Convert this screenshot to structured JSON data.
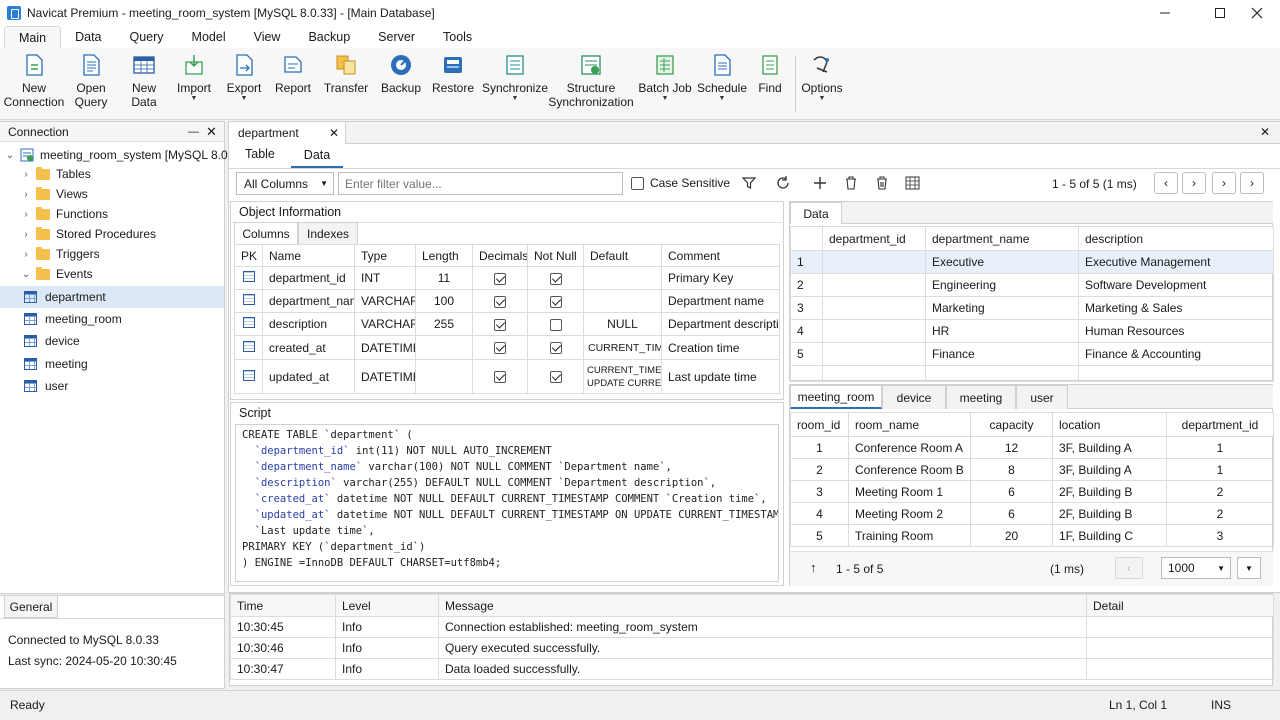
{
  "window": {
    "title": "Navicat Premium - meeting_room_system [MySQL 8.0.33] - [Main Database]"
  },
  "menu": [
    "Main",
    "Data",
    "Query",
    "Model",
    "View",
    "Backup",
    "Server",
    "Tools"
  ],
  "ribbon": {
    "new_connection": "New\nConnection",
    "open_query": "Open\nQuery",
    "new_data": "New\nData",
    "import": "Import",
    "export": "Export",
    "report": "Report",
    "transfer": "Transfer",
    "backup": "Backup",
    "restore": "Restore",
    "synchronize": "Synchronize",
    "structure_sync": "Structure\nSynchronization",
    "batch_job": "Batch Job",
    "schedule": "Schedule",
    "find": "Find",
    "options": "Options"
  },
  "connection_panel": {
    "title": "Connection",
    "root": "meeting_room_system [MySQL 8.0.33]",
    "folders": [
      "Tables",
      "Views",
      "Functions",
      "Stored Procedures",
      "Triggers",
      "Events"
    ],
    "tables": [
      "department",
      "meeting_room",
      "device",
      "meeting",
      "user"
    ]
  },
  "general_panel": {
    "tab": "General",
    "connected": "Connected to MySQL 8.0.33",
    "last_sync": "Last sync: 2024-05-20 10:30:45"
  },
  "editor": {
    "doc_tab": "department",
    "subtabs": [
      "Table",
      "Data"
    ],
    "filter": {
      "column_select": "All Columns",
      "placeholder": "Enter filter value...",
      "case_sensitive": "Case Sensitive"
    },
    "paging": "1 - 5 of 5 (1 ms)"
  },
  "object_info": {
    "title": "Object Information",
    "tabs": [
      "Columns",
      "Indexes"
    ],
    "headers": [
      "PK",
      "Name",
      "Type",
      "Length",
      "Decimals",
      "Not Null",
      "Default",
      "Comment"
    ],
    "rows": [
      {
        "name": "department_id",
        "type": "INT",
        "length": "11",
        "decimals": true,
        "notnull": true,
        "default": "",
        "comment": "Primary Key"
      },
      {
        "name": "department_name",
        "type": "VARCHAR",
        "length": "100",
        "decimals": true,
        "notnull": true,
        "default": "",
        "comment": "Department name"
      },
      {
        "name": "description",
        "type": "VARCHAR",
        "length": "255",
        "decimals": true,
        "notnull": false,
        "default": "NULL",
        "comment": "Department description"
      },
      {
        "name": "created_at",
        "type": "DATETIME",
        "length": "",
        "decimals": true,
        "notnull": true,
        "default": "CURRENT_TIMESTAMP",
        "comment": "Creation time"
      },
      {
        "name": "updated_at",
        "type": "DATETIME",
        "length": "",
        "decimals": true,
        "notnull": true,
        "default": "CURRENT_TIMESTAMP ON\nUPDATE CURRENT_TIMESTAMP",
        "comment": "Last update time"
      }
    ]
  },
  "script": {
    "title": "Script",
    "lines": [
      [
        "CREATE TABLE `department` (",
        ""
      ],
      [
        "  `department_id`",
        " int(11) NOT NULL AUTO_INCREMENT"
      ],
      [
        "  `department_name`",
        " varchar(100) NOT NULL COMMENT `Department name`,"
      ],
      [
        "  `description`",
        " varchar(255) DEFAULT NULL COMMENT `Department description`,"
      ],
      [
        "  `created_at`",
        " datetime NOT NULL DEFAULT CURRENT_TIMESTAMP COMMENT `Creation time`,"
      ],
      [
        "  `updated_at`",
        " datetime NOT NULL DEFAULT CURRENT_TIMESTAMP ON UPDATE CURRENT_TIMESTAMP COMMENT"
      ],
      [
        "  `Last update time`,",
        ""
      ],
      [
        "PRIMARY KEY (`department_id`)",
        ""
      ],
      [
        ") ENGINE =InnoDB DEFAULT CHARSET=utf8mb4;",
        ""
      ]
    ]
  },
  "data_grid": {
    "tab": "Data",
    "headers": [
      "department_id",
      "department_name",
      "description"
    ],
    "rows": [
      [
        "1",
        "",
        "Executive",
        "Executive Management"
      ],
      [
        "2",
        "",
        "Engineering",
        "Software Development"
      ],
      [
        "3",
        "",
        "Marketing",
        "Marketing & Sales"
      ],
      [
        "4",
        "",
        "HR",
        "Human Resources"
      ],
      [
        "5",
        "",
        "Finance",
        "Finance & Accounting"
      ]
    ]
  },
  "related": {
    "tabs": [
      "meeting_room",
      "device",
      "meeting",
      "user"
    ],
    "headers": [
      "room_id",
      "room_name",
      "capacity",
      "location",
      "department_id"
    ],
    "rows": [
      [
        "1",
        "Conference Room A",
        "12",
        "3F, Building A",
        "1"
      ],
      [
        "2",
        "Conference Room B",
        "8",
        "3F, Building A",
        "1"
      ],
      [
        "3",
        "Meeting Room 1",
        "6",
        "2F, Building B",
        "2"
      ],
      [
        "4",
        "Meeting Room 2",
        "6",
        "2F, Building B",
        "2"
      ],
      [
        "5",
        "Training Room",
        "20",
        "1F, Building C",
        "3"
      ]
    ],
    "footer": {
      "count": "1 - 5 of 5",
      "time": "(1 ms)",
      "limit": "1000"
    }
  },
  "log": {
    "headers": [
      "Time",
      "Level",
      "Message",
      "Detail"
    ],
    "rows": [
      [
        "10:30:45",
        "Info",
        "Connection established: meeting_room_system"
      ],
      [
        "10:30:46",
        "Info",
        "Query executed successfully."
      ],
      [
        "10:30:47",
        "Info",
        "Data loaded successfully."
      ]
    ]
  },
  "status": {
    "left": "Ready",
    "position": "Ln 1, Col 1",
    "mode": "INS"
  }
}
